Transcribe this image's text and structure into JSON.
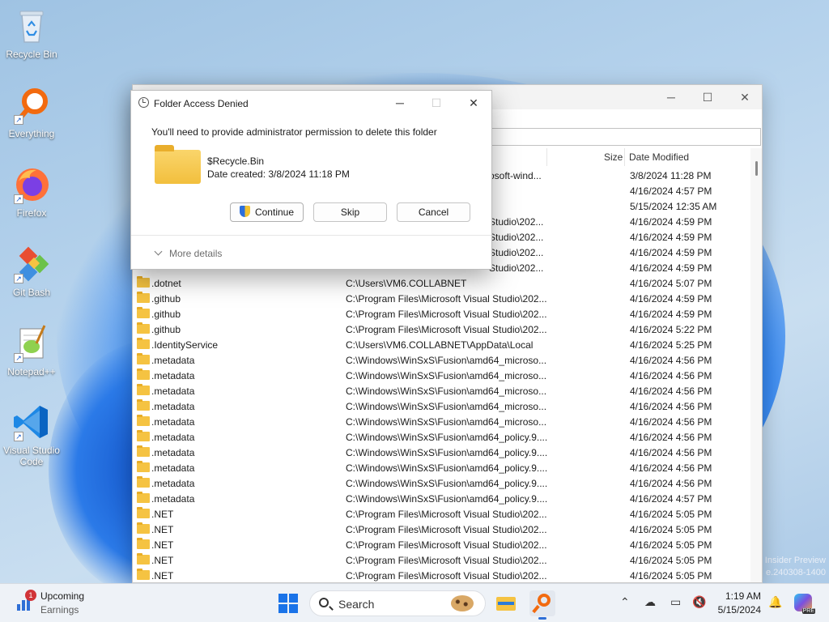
{
  "desktop": {
    "icons": [
      {
        "label": "Recycle Bin",
        "icon": "recycle-bin-icon"
      },
      {
        "label": "Everything",
        "icon": "everything-icon"
      },
      {
        "label": "Firefox",
        "icon": "firefox-icon"
      },
      {
        "label": "Git Bash",
        "icon": "git-bash-icon"
      },
      {
        "label": "Notepad++",
        "icon": "notepad-plus-plus-icon"
      },
      {
        "label": "Visual Studio Code",
        "icon": "vscode-icon"
      }
    ],
    "watermark_line1": "Insider Preview",
    "watermark_line2": "e.240308-1400"
  },
  "explorer": {
    "columns": {
      "size": "Size",
      "date": "Date Modified"
    },
    "rows": [
      {
        "name": "",
        "path": "osoft-wind...",
        "date": "3/8/2024 11:28 PM"
      },
      {
        "name": "",
        "path": "",
        "date": "4/16/2024 4:57 PM"
      },
      {
        "name": "",
        "path": "",
        "date": "5/15/2024 12:35 AM"
      },
      {
        "name": "",
        "path": "Studio\\202...",
        "date": "4/16/2024 4:59 PM"
      },
      {
        "name": "",
        "path": "Studio\\202...",
        "date": "4/16/2024 4:59 PM"
      },
      {
        "name": "",
        "path": "Studio\\202...",
        "date": "4/16/2024 4:59 PM"
      },
      {
        "name": "",
        "path": "Studio\\202...",
        "date": "4/16/2024 4:59 PM"
      },
      {
        "name": ".dotnet",
        "path": "C:\\Users\\VM6.COLLABNET",
        "date": "4/16/2024 5:07 PM"
      },
      {
        "name": ".github",
        "path": "C:\\Program Files\\Microsoft Visual Studio\\202...",
        "date": "4/16/2024 4:59 PM"
      },
      {
        "name": ".github",
        "path": "C:\\Program Files\\Microsoft Visual Studio\\202...",
        "date": "4/16/2024 4:59 PM"
      },
      {
        "name": ".github",
        "path": "C:\\Program Files\\Microsoft Visual Studio\\202...",
        "date": "4/16/2024 5:22 PM"
      },
      {
        "name": ".IdentityService",
        "path": "C:\\Users\\VM6.COLLABNET\\AppData\\Local",
        "date": "4/16/2024 5:25 PM"
      },
      {
        "name": ".metadata",
        "path": "C:\\Windows\\WinSxS\\Fusion\\amd64_microso...",
        "date": "4/16/2024 4:56 PM"
      },
      {
        "name": ".metadata",
        "path": "C:\\Windows\\WinSxS\\Fusion\\amd64_microso...",
        "date": "4/16/2024 4:56 PM"
      },
      {
        "name": ".metadata",
        "path": "C:\\Windows\\WinSxS\\Fusion\\amd64_microso...",
        "date": "4/16/2024 4:56 PM"
      },
      {
        "name": ".metadata",
        "path": "C:\\Windows\\WinSxS\\Fusion\\amd64_microso...",
        "date": "4/16/2024 4:56 PM"
      },
      {
        "name": ".metadata",
        "path": "C:\\Windows\\WinSxS\\Fusion\\amd64_microso...",
        "date": "4/16/2024 4:56 PM"
      },
      {
        "name": ".metadata",
        "path": "C:\\Windows\\WinSxS\\Fusion\\amd64_policy.9....",
        "date": "4/16/2024 4:56 PM"
      },
      {
        "name": ".metadata",
        "path": "C:\\Windows\\WinSxS\\Fusion\\amd64_policy.9....",
        "date": "4/16/2024 4:56 PM"
      },
      {
        "name": ".metadata",
        "path": "C:\\Windows\\WinSxS\\Fusion\\amd64_policy.9....",
        "date": "4/16/2024 4:56 PM"
      },
      {
        "name": ".metadata",
        "path": "C:\\Windows\\WinSxS\\Fusion\\amd64_policy.9....",
        "date": "4/16/2024 4:56 PM"
      },
      {
        "name": ".metadata",
        "path": "C:\\Windows\\WinSxS\\Fusion\\amd64_policy.9....",
        "date": "4/16/2024 4:57 PM"
      },
      {
        "name": ".NET",
        "path": "C:\\Program Files\\Microsoft Visual Studio\\202...",
        "date": "4/16/2024 5:05 PM"
      },
      {
        "name": ".NET",
        "path": "C:\\Program Files\\Microsoft Visual Studio\\202...",
        "date": "4/16/2024 5:05 PM"
      },
      {
        "name": ".NET",
        "path": "C:\\Program Files\\Microsoft Visual Studio\\202...",
        "date": "4/16/2024 5:05 PM"
      },
      {
        "name": ".NET",
        "path": "C:\\Program Files\\Microsoft Visual Studio\\202...",
        "date": "4/16/2024 5:05 PM"
      },
      {
        "name": ".NET",
        "path": "C:\\Program Files\\Microsoft Visual Studio\\202...",
        "date": "4/16/2024 5:05 PM"
      }
    ]
  },
  "dialog": {
    "title": "Folder Access Denied",
    "message": "You'll need to provide administrator permission to delete this folder",
    "folder_name": "$Recycle.Bin",
    "date_created": "Date created: 3/8/2024 11:18 PM",
    "continue_label": "Continue",
    "skip_label": "Skip",
    "cancel_label": "Cancel",
    "more_details_label": "More details"
  },
  "taskbar": {
    "weather_badge": "1",
    "weather_title": "Upcoming",
    "weather_sub": "Earnings",
    "search_placeholder": "Search",
    "time": "1:19 AM",
    "date": "5/15/2024",
    "copilot_badge": "PRE"
  },
  "colors": {
    "accent": "#1a73e8",
    "folder": "#f5c342",
    "everything_orange": "#f26a0f",
    "badge_red": "#d13438"
  }
}
